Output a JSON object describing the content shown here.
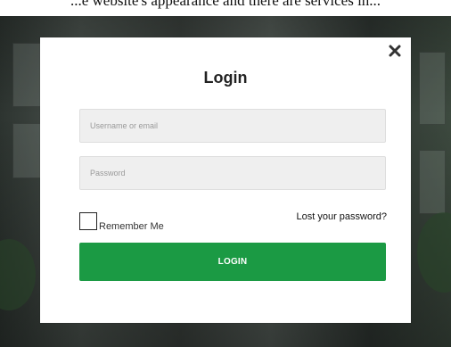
{
  "page": {
    "header_text": "...e website's appearance and there are services in..."
  },
  "login_modal": {
    "title": "Login",
    "username_placeholder": "Username or email",
    "password_placeholder": "Password",
    "remember_label": "Remember Me",
    "remember_checked": false,
    "lost_password_label": "Lost your password?",
    "submit_label": "LOGIN",
    "close_icon": "close-icon"
  },
  "colors": {
    "primary_button": "#1b9a44",
    "input_background": "#efefef",
    "modal_background": "#ffffff"
  }
}
